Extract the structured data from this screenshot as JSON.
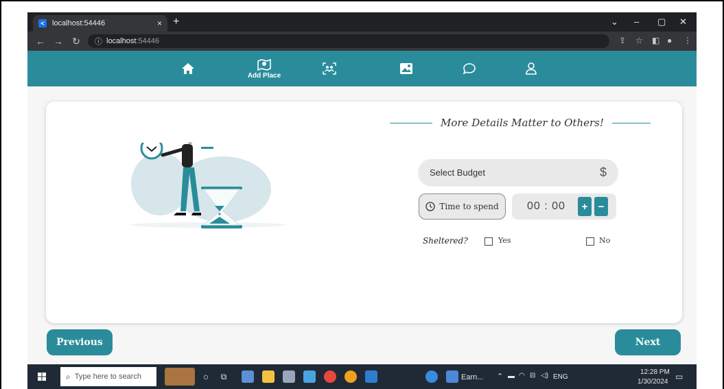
{
  "browser": {
    "tab_title": "localhost:54446",
    "tab_close": "×",
    "new_tab": "+",
    "url_host": "localhost",
    "url_port": ":54446",
    "window_controls": [
      "⌄",
      "–",
      "▢",
      "✕"
    ]
  },
  "nav": {
    "items": [
      {
        "icon": "home-icon",
        "label": ""
      },
      {
        "icon": "map-pin-icon",
        "label": "Add Place"
      },
      {
        "icon": "group-scan-icon",
        "label": ""
      },
      {
        "icon": "gallery-icon",
        "label": ""
      },
      {
        "icon": "chat-bubble-icon",
        "label": ""
      },
      {
        "icon": "user-icon",
        "label": ""
      }
    ],
    "color": "#2a8c9a"
  },
  "form": {
    "heading": "More Details Matter to Others!",
    "budget_placeholder": "Select Budget",
    "budget_icon": "$",
    "time_button": "Time to spend",
    "time_value": "00 : 00",
    "plus": "+",
    "minus": "−",
    "sheltered_label": "Sheltered?",
    "yes_label": "Yes",
    "no_label": "No"
  },
  "buttons": {
    "previous": "Previous",
    "next": "Next"
  },
  "taskbar": {
    "search_placeholder": "Type here to search",
    "app_label": "Earn...",
    "lang": "ENG",
    "time": "12:28 PM",
    "date": "1/30/2024"
  }
}
